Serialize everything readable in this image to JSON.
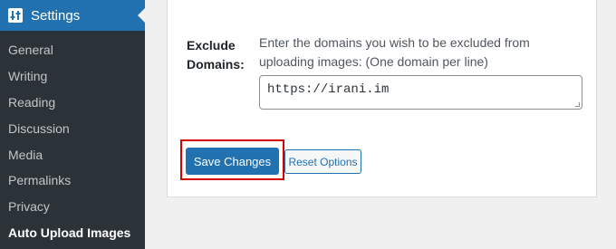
{
  "sidebar": {
    "header": {
      "title": "Settings",
      "icon": "settings-sliders-icon"
    },
    "items": [
      {
        "label": "General"
      },
      {
        "label": "Writing"
      },
      {
        "label": "Reading"
      },
      {
        "label": "Discussion"
      },
      {
        "label": "Media"
      },
      {
        "label": "Permalinks"
      },
      {
        "label": "Privacy"
      },
      {
        "label": "Auto Upload Images",
        "current": true
      }
    ]
  },
  "form": {
    "exclude_domains_label": "Exclude Domains:",
    "exclude_domains_description": "Enter the domains you wish to be excluded from uploading images: (One domain per line)",
    "exclude_domains_value": "https://irani.im"
  },
  "actions": {
    "save_label": "Save Changes",
    "reset_label": "Reset Options"
  },
  "colors": {
    "sidebar_bg": "#2c3338",
    "accent": "#2271b1",
    "highlight": "#d40000"
  }
}
